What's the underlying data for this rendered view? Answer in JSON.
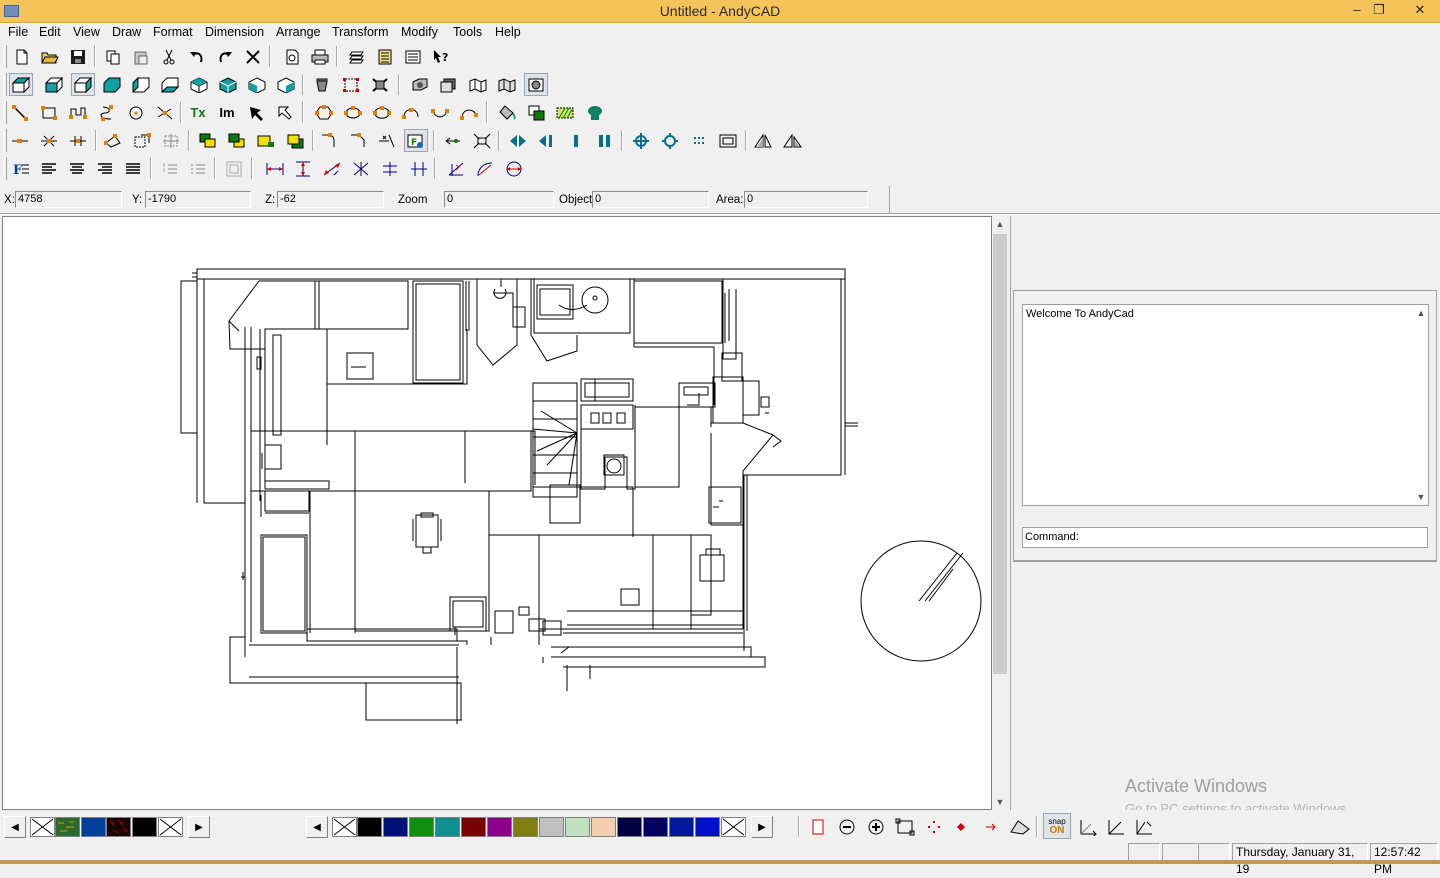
{
  "window": {
    "title": "Untitled - AndyCAD",
    "minimize": "–",
    "restore": "❐",
    "close": "✕"
  },
  "menu": [
    "File",
    "Edit",
    "View",
    "Draw",
    "Format",
    "Dimension",
    "Arrange",
    "Transform",
    "Modify",
    "Tools",
    "Help"
  ],
  "toolbar": {
    "row1": [
      "new-file-icon",
      "open-folder-icon",
      "save-icon",
      "copy-icon",
      "paste-icon",
      "cut-icon",
      "undo-icon",
      "redo-icon",
      "delete-icon",
      "print-preview-icon",
      "print-icon",
      "layers-icon",
      "properties-icon",
      "list-icon",
      "help-icon"
    ],
    "row2": [
      "view-top-icon",
      "view-front-icon",
      "view-right-icon",
      "view-back-icon",
      "view-left-icon",
      "view-bottom-icon",
      "view-iso1-icon",
      "view-iso2-icon",
      "view-iso3-icon",
      "view-iso4-icon",
      "render-icon",
      "zoom-window-icon",
      "camera-icon",
      "render-solid-icon",
      "render-wire-icon",
      "render-shade-icon",
      "render-hidden-icon",
      "render-light-icon"
    ],
    "row2_text": [
      "",
      "",
      "",
      "",
      "",
      "",
      "",
      "",
      "",
      "",
      "",
      "",
      "",
      "",
      "",
      "",
      "",
      ""
    ],
    "row3_text": {
      "text_tool": "Tx",
      "image_tool": "Im"
    },
    "row3": [
      "line-icon",
      "rectangle-icon",
      "polyline-icon",
      "spline-icon",
      "circle-icon",
      "construction-line-icon",
      "text-tool-icon",
      "image-tool-icon",
      "select-arrow-icon",
      "select-arrow-outline-icon",
      "polygon-icon",
      "ellipse-icon",
      "arc-3pt-icon",
      "arc-icon",
      "wave-icon",
      "arc-alt-icon",
      "fill-bucket-icon",
      "group-icon",
      "hatch-icon",
      "solid-icon"
    ],
    "row4": [
      "snap-end-icon",
      "snap-mid-icon",
      "snap-perp-icon",
      "rotate-icon",
      "scale-icon",
      "stretch-icon",
      "bring-front-icon",
      "send-back-icon",
      "bring-forward-icon",
      "send-backward-icon",
      "fillet-icon",
      "chamfer-icon",
      "trim-icon",
      "extend-icon",
      "move-icon",
      "fit-icon",
      "mirror-h-icon",
      "mirror-left-icon",
      "mirror-bar-icon",
      "mirror-v-icon",
      "zoom-in-icon",
      "zoom-out-icon",
      "grid-icon",
      "zoom-extent-icon",
      "perspective-icon",
      "perspective-alt-icon"
    ],
    "row5": [
      "font-icon",
      "align-left-icon",
      "align-center-icon",
      "align-right-icon",
      "justify-icon",
      "numbered-list-icon",
      "bullet-list-icon",
      "border-icon",
      "dim-horizontal-icon",
      "dim-vertical-icon",
      "dim-aligned-icon",
      "dim-cross-icon",
      "dim-center-icon",
      "dim-parallel-icon",
      "dim-angle-icon",
      "dim-radius-icon",
      "dim-diameter-icon"
    ]
  },
  "coords": {
    "x_label": "X:",
    "x_value": "4758",
    "y_label": "Y:",
    "y_value": "-1790",
    "z_label": "Z:",
    "z_value": "-62",
    "zoom_label": "Zoom",
    "zoom_value": "0",
    "object_label": "Object",
    "object_value": "0",
    "area_label": "Area:",
    "area_value": "0"
  },
  "panel": {
    "output_text": "Welcome To AndyCad",
    "command_label": "Command:"
  },
  "watermark": {
    "line1": "Activate Windows",
    "line2": "Go to PC settings to activate Windows."
  },
  "palette": {
    "left": [
      "#ffffff",
      "#2d6a2d",
      "#003f9a",
      "#2b0000",
      "#000000",
      "#ffffff"
    ],
    "right": [
      "#ffffff",
      "#000000",
      "#001077",
      "#0f8f0f",
      "#0f8f8f",
      "#7a0000",
      "#8a008a",
      "#7f7f0f",
      "#c0c0c0",
      "#c0e0c0",
      "#f4d0b0",
      "#000040",
      "#000060",
      "#0018a0",
      "#0010c8",
      "#ffffff"
    ]
  },
  "snap": {
    "label_top": "snap",
    "label_bottom": "ON"
  },
  "status": {
    "date": "Thursday, January 31, 19",
    "time": "12:57:42 PM"
  }
}
